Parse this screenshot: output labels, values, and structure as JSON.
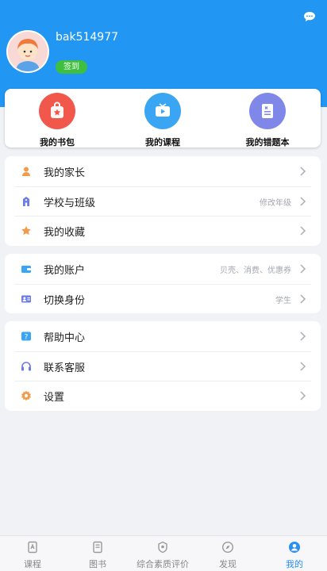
{
  "profile": {
    "username": "bak514977",
    "signin_label": "签到"
  },
  "quick_actions": [
    {
      "label": "我的书包",
      "icon": "schoolbag-icon",
      "color": "#f2574c"
    },
    {
      "label": "我的课程",
      "icon": "tv-course-icon",
      "color": "#3aa6f3"
    },
    {
      "label": "我的错题本",
      "icon": "notebook-icon",
      "color": "#7f87e8"
    }
  ],
  "menu_group_1": [
    {
      "label": "我的家长",
      "hint": "",
      "icon": "parent-icon"
    },
    {
      "label": "学校与班级",
      "hint": "修改年级",
      "icon": "school-icon"
    },
    {
      "label": "我的收藏",
      "hint": "",
      "icon": "favorite-icon"
    }
  ],
  "menu_group_2": [
    {
      "label": "我的账户",
      "hint": "贝壳、消费、优惠券",
      "icon": "wallet-icon"
    },
    {
      "label": "切换身份",
      "hint": "学生",
      "icon": "id-card-icon"
    }
  ],
  "menu_group_3": [
    {
      "label": "帮助中心",
      "hint": "",
      "icon": "help-icon"
    },
    {
      "label": "联系客服",
      "hint": "",
      "icon": "headset-icon"
    },
    {
      "label": "设置",
      "hint": "",
      "icon": "settings-icon"
    }
  ],
  "tabbar": {
    "items": [
      {
        "label": "课程",
        "icon": "course-tab-icon"
      },
      {
        "label": "图书",
        "icon": "book-tab-icon"
      },
      {
        "label": "综合素质评价",
        "icon": "evaluation-tab-icon"
      },
      {
        "label": "发现",
        "icon": "discover-tab-icon"
      },
      {
        "label": "我的",
        "icon": "me-tab-icon"
      }
    ],
    "active_index": 4
  },
  "colors": {
    "header_blue": "#2196f3",
    "signin_green": "#3fbf3f",
    "active_tab": "#2a8ff0"
  }
}
